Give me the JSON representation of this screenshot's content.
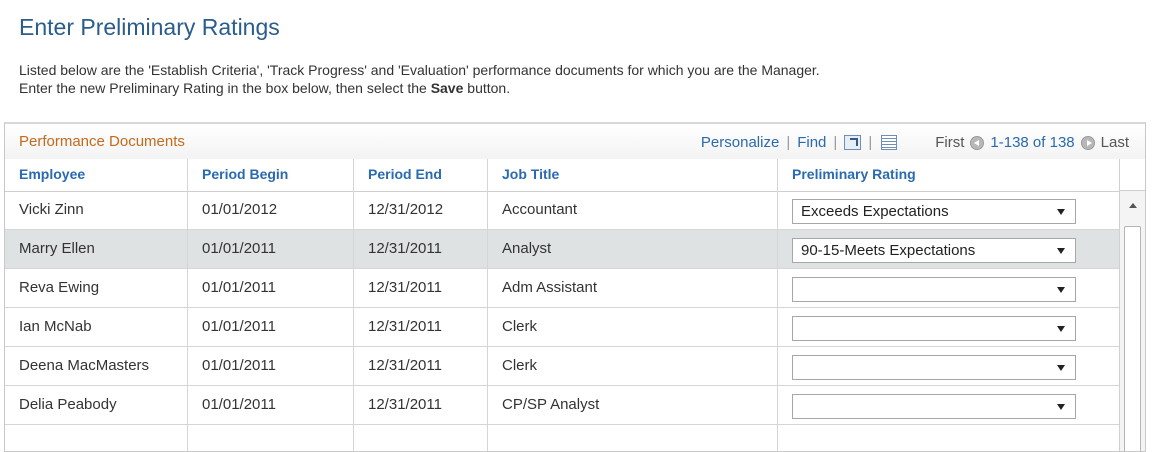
{
  "page": {
    "title": "Enter Preliminary Ratings",
    "instructions": {
      "line1": "Listed below are the 'Establish Criteria', 'Track Progress' and 'Evaluation' performance documents for which you are the Manager.",
      "line2_before": "Enter the new Preliminary Rating in the box below, then select the ",
      "line2_bold": "Save",
      "line2_after": " button."
    }
  },
  "grid": {
    "title": "Performance Documents",
    "nav": {
      "personalize": "Personalize",
      "find": "Find",
      "separator": "|",
      "first": "First",
      "range": "1-138 of 138",
      "last": "Last"
    },
    "columns": [
      "Employee",
      "Period Begin",
      "Period End",
      "Job Title",
      "Preliminary Rating"
    ],
    "rows": [
      {
        "employee": "Vicki Zinn",
        "begin": "01/01/2012",
        "end": "12/31/2012",
        "job": "Accountant",
        "rating": "Exceeds Expectations"
      },
      {
        "employee": "Marry Ellen",
        "begin": "01/01/2011",
        "end": "12/31/2011",
        "job": "Analyst",
        "rating": "90-15-Meets Expectations"
      },
      {
        "employee": "Reva Ewing",
        "begin": "01/01/2011",
        "end": "12/31/2011",
        "job": "Adm Assistant",
        "rating": ""
      },
      {
        "employee": "Ian McNab",
        "begin": "01/01/2011",
        "end": "12/31/2011",
        "job": "Clerk",
        "rating": ""
      },
      {
        "employee": "Deena MacMasters",
        "begin": "01/01/2011",
        "end": "12/31/2011",
        "job": "Clerk",
        "rating": ""
      },
      {
        "employee": "Delia Peabody",
        "begin": "01/01/2011",
        "end": "12/31/2011",
        "job": "CP/SP Analyst",
        "rating": ""
      }
    ]
  },
  "colors": {
    "title": "#2a5c8c",
    "grid_title": "#c46a1b",
    "link": "#2a6ab0",
    "alt_row": "#dfe2e2"
  },
  "icons": {
    "zoom": "zoom-grid-icon",
    "download": "download-to-excel-icon",
    "first": "previous-arrow-icon",
    "last": "next-arrow-icon",
    "select": "dropdown-arrow-icon"
  }
}
